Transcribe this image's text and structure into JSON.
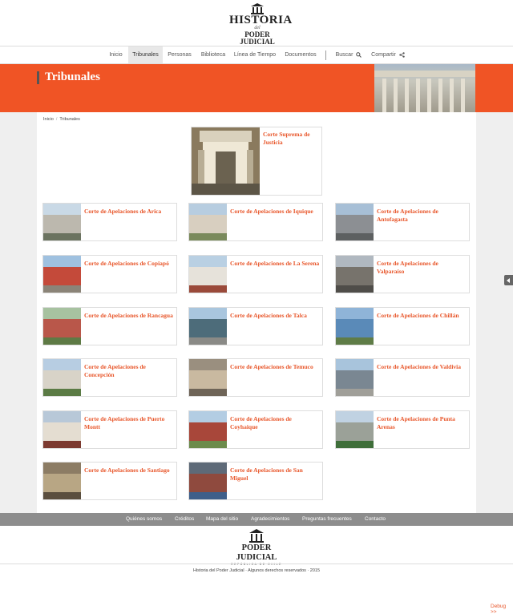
{
  "logo": {
    "line1": "HISTORIA",
    "line2": "del",
    "line3": "PODER JUDICIAL",
    "line4": "REPÚBLICA DE CHILE"
  },
  "nav": {
    "items": [
      "Inicio",
      "Tribunales",
      "Personas",
      "Biblioteca",
      "Línea de Tiempo",
      "Documentos"
    ],
    "active": "Tribunales",
    "search_label": "Buscar",
    "share_label": "Compartir"
  },
  "banner": {
    "title": "Tribunales"
  },
  "breadcrumb": [
    "Inicio",
    "Tribunales"
  ],
  "courts": {
    "supreme": "Corte Suprema de Justicia",
    "appeals": [
      "Corte de Apelaciones de Arica",
      "Corte de Apelaciones de Iquique",
      "Corte de Apelaciones de Antofagasta",
      "Corte de Apelaciones de Copiapó",
      "Corte de Apelaciones de La Serena",
      "Corte de Apelaciones de Valparaíso",
      "Corte de Apelaciones de Rancagua",
      "Corte de Apelaciones de Talca",
      "Corte de Apelaciones de Chillán",
      "Corte de Apelaciones de Concepción",
      "Corte de Apelaciones de Temuco",
      "Corte de Apelaciones de Valdivia",
      "Corte de Apelaciones de Puerto Montt",
      "Corte de Apelaciones de Coyhaique",
      "Corte de Apelaciones de Punta Arenas",
      "Corte de Apelaciones de Santiago",
      "Corte de Apelaciones de San Miguel"
    ]
  },
  "footer_nav": [
    "Quiénes somos",
    "Créditos",
    "Mapa del sitio",
    "Agradecimientos",
    "Preguntas frecuentes",
    "Contacto"
  ],
  "footer_logo": {
    "line1": "PODER JUDICIAL",
    "line2": "REPÚBLICA DE CHILE"
  },
  "copyright": "Historia del Poder Judicial · Algunos derechos reservados · 2015",
  "debug_label": "Debug >>",
  "colors": {
    "accent": "#f05425",
    "title": "#e8562a",
    "footer_bar": "#8d8d8d"
  }
}
